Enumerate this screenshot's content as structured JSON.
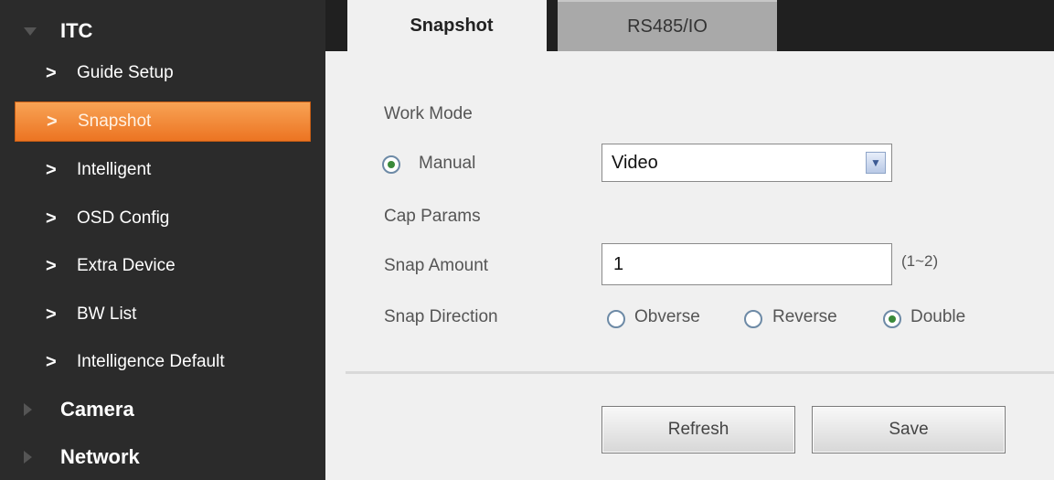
{
  "sidebar": {
    "group_itc": "ITC",
    "items": [
      {
        "label": "Guide Setup"
      },
      {
        "label": "Snapshot",
        "active": true
      },
      {
        "label": "Intelligent"
      },
      {
        "label": "OSD Config"
      },
      {
        "label": "Extra Device"
      },
      {
        "label": "BW List"
      },
      {
        "label": "Intelligence Default"
      }
    ],
    "group_camera": "Camera",
    "group_network": "Network",
    "chevron": ">"
  },
  "tabs": {
    "snapshot": "Snapshot",
    "rs485": "RS485/IO",
    "active": "Snapshot"
  },
  "form": {
    "work_mode_label": "Work Mode",
    "mode_option": "Manual",
    "mode_selected": true,
    "mode_select_value": "Video",
    "cap_params_label": "Cap Params",
    "snap_amount_label": "Snap Amount",
    "snap_amount_value": "1",
    "snap_amount_range": "(1~2)",
    "snap_direction_label": "Snap Direction",
    "direction_options": [
      "Obverse",
      "Reverse",
      "Double"
    ],
    "direction_selected": "Double"
  },
  "buttons": {
    "refresh": "Refresh",
    "save": "Save"
  },
  "colors": {
    "sidebar_bg": "#2b2b2b",
    "active_item": "#ec7422",
    "tabbar_bg": "#202020",
    "content_bg": "#f0f0f0"
  },
  "icons": {
    "expand": "triangle-down-icon",
    "collapse": "triangle-right-icon",
    "nav": "chevron-right-icon",
    "select": "dropdown-arrow-icon"
  }
}
